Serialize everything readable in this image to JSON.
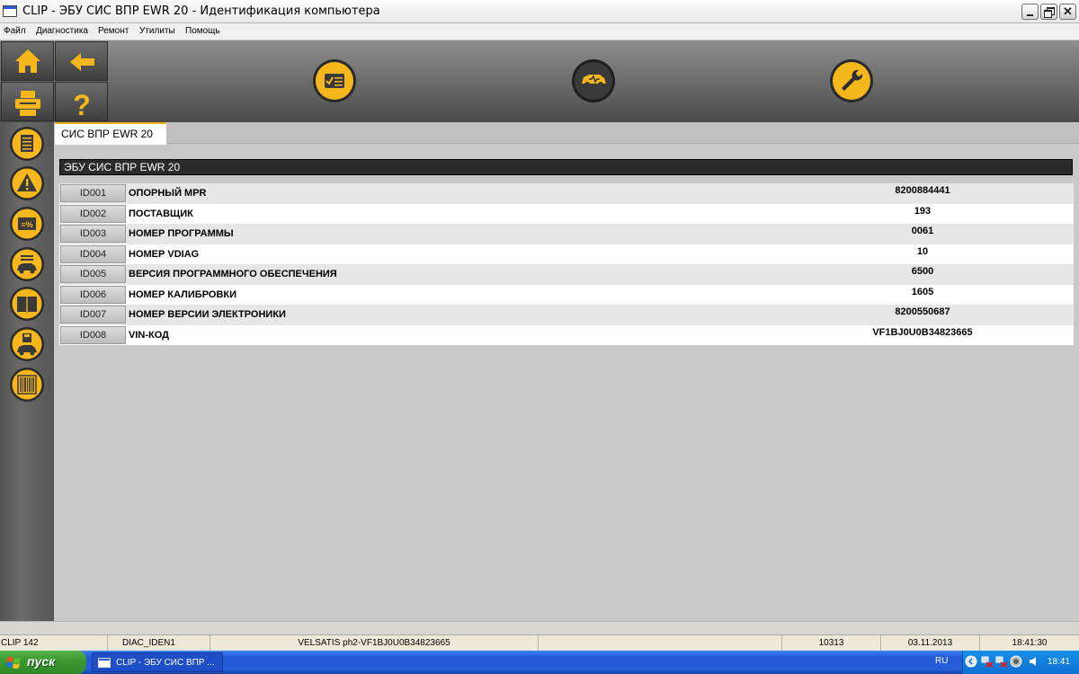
{
  "window": {
    "title": "CLIP - ЭБУ СИС ВПР EWR 20 - Идентификация компьютера"
  },
  "menu": [
    "Файл",
    "Диагностика",
    "Ремонт",
    "Утилиты",
    "Помощь"
  ],
  "toolbar": {
    "left_tiles": [
      "home-icon",
      "back-arrow-icon",
      "printer-icon",
      "help-icon"
    ],
    "main_buttons": [
      "checklist-icon",
      "car-diagnostic-icon",
      "wrench-icon"
    ]
  },
  "sidebar": {
    "icons": [
      "document-icon",
      "warning-icon",
      "percent-icon",
      "car-list-icon",
      "book-icon",
      "car-save-icon",
      "barcode-icon"
    ]
  },
  "tab": {
    "label": "СИС ВПР EWR 20"
  },
  "panel": {
    "header": "ЭБУ СИС ВПР EWR 20"
  },
  "rows": [
    {
      "id": "ID001",
      "label": "ОПОРНЫЙ MPR",
      "value": "8200884441"
    },
    {
      "id": "ID002",
      "label": "ПОСТАВЩИК",
      "value": "193"
    },
    {
      "id": "ID003",
      "label": "НОМЕР ПРОГРАММЫ",
      "value": "0061"
    },
    {
      "id": "ID004",
      "label": "НОМЕР VDIAG",
      "value": "10"
    },
    {
      "id": "ID005",
      "label": "ВЕРСИЯ ПРОГРАММНОГО ОБЕСПЕЧЕНИЯ",
      "value": "6500"
    },
    {
      "id": "ID006",
      "label": "НОМЕР КАЛИБРОВКИ",
      "value": "1605"
    },
    {
      "id": "ID007",
      "label": "НОМЕР ВЕРСИИ ЭЛЕКТРОНИКИ",
      "value": "8200550687"
    },
    {
      "id": "ID008",
      "label": "VIN-КОД",
      "value": "VF1BJ0U0B34823665"
    }
  ],
  "status": {
    "clip": "CLIP 142",
    "screen": "DIAC_IDEN1",
    "vehicle": "VELSATIS ph2-VF1BJ0U0B34823665",
    "code": "10313",
    "date": "03.11.2013",
    "time": "18:41:30"
  },
  "taskbar": {
    "start": "пуск",
    "task": "CLIP - ЭБУ СИС ВПР ...",
    "lang": "RU",
    "clock": "18:41"
  },
  "colors": {
    "accent": "#f5b71c",
    "row_odd": "#e6e6e6",
    "row_even": "#ffffff",
    "header_bg": "#2b2b2b"
  }
}
